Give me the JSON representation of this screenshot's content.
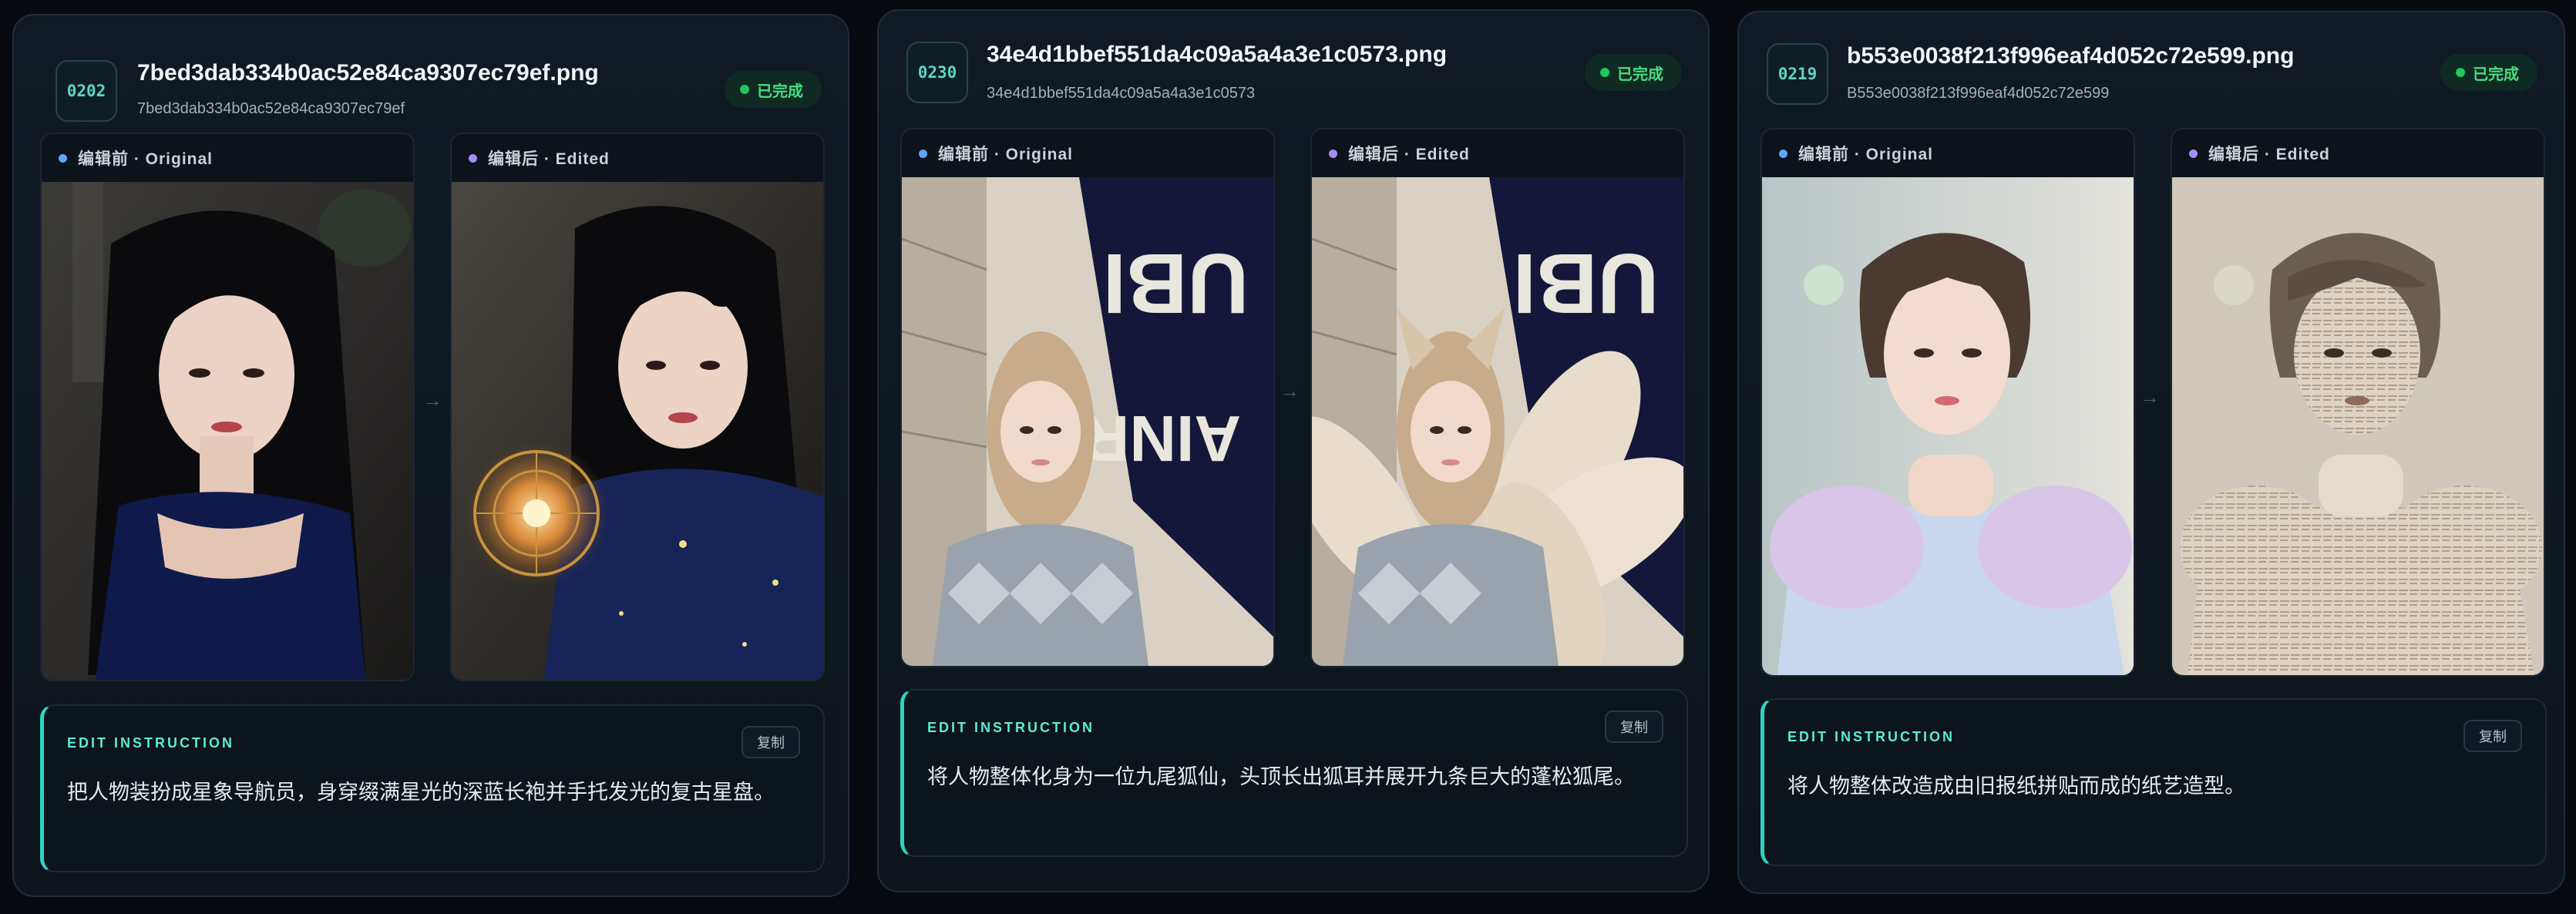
{
  "colors": {
    "background": "#070b10",
    "card": "#111a24",
    "accent_teal": "#2dd4bf",
    "status_green": "#4ade80",
    "original_dot": "#60a5fa",
    "edited_dot": "#a78bfa"
  },
  "cards": [
    {
      "id": "0202",
      "file_name": "7bed3dab334b0ac52e84ca9307ec79ef.png",
      "file_hash": "7bed3dab334b0ac52e84ca9307ec79ef",
      "status": "已完成",
      "original_label": "编辑前 · Original",
      "edited_label": "编辑后 · Edited",
      "instruction_title": "EDIT INSTRUCTION",
      "copy_label": "复制",
      "instruction": "把人物装扮成星象导航员，身穿缀满星光的深蓝长袍并手托发光的复古星盘。"
    },
    {
      "id": "0230",
      "file_name": "34e4d1bbef551da4c09a5a4a3e1c0573.png",
      "file_hash": "34e4d1bbef551da4c09a5a4a3e1c0573",
      "status": "已完成",
      "original_label": "编辑前 · Original",
      "edited_label": "编辑后 · Edited",
      "instruction_title": "EDIT INSTRUCTION",
      "copy_label": "复制",
      "instruction": "将人物整体化身为一位九尾狐仙，头顶长出狐耳并展开九条巨大的蓬松狐尾。"
    },
    {
      "id": "0219",
      "file_name": "b553e0038f213f996eaf4d052c72e599.png",
      "file_hash": "B553e0038f213f996eaf4d052c72e599",
      "status": "已完成",
      "original_label": "编辑前 · Original",
      "edited_label": "编辑后 · Edited",
      "instruction_title": "EDIT INSTRUCTION",
      "copy_label": "复制",
      "instruction": "将人物整体改造成由旧报纸拼贴而成的纸艺造型。"
    }
  ],
  "icons": {
    "arrow": "arrow-right-icon",
    "status": "status-dot-icon"
  }
}
